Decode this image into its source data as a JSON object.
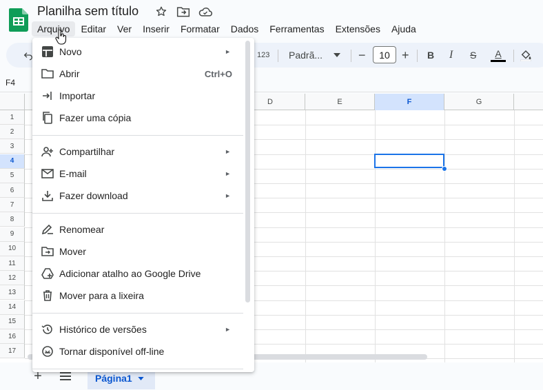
{
  "document": {
    "title": "Planilha sem título"
  },
  "menubar": [
    {
      "id": "arquivo",
      "label": "Arquivo",
      "active": true
    },
    {
      "id": "editar",
      "label": "Editar"
    },
    {
      "id": "ver",
      "label": "Ver"
    },
    {
      "id": "inserir",
      "label": "Inserir"
    },
    {
      "id": "formatar",
      "label": "Formatar"
    },
    {
      "id": "dados",
      "label": "Dados"
    },
    {
      "id": "ferramentas",
      "label": "Ferramentas"
    },
    {
      "id": "extensoes",
      "label": "Extensões"
    },
    {
      "id": "ajuda",
      "label": "Ajuda"
    }
  ],
  "toolbar": {
    "number_format": "123",
    "font_name": "Padrã...",
    "font_size": "10",
    "decrease": "−",
    "increase": "+",
    "bold": "B",
    "italic": "I",
    "strike": "S",
    "text_color": "A"
  },
  "namebox": {
    "value": "F4"
  },
  "grid": {
    "columns": [
      {
        "label": "D",
        "selected": false
      },
      {
        "label": "E",
        "selected": false
      },
      {
        "label": "F",
        "selected": true
      },
      {
        "label": "G",
        "selected": false
      }
    ],
    "rows": [
      "1",
      "2",
      "3",
      "4",
      "5",
      "6",
      "7",
      "8",
      "9",
      "10",
      "11",
      "12",
      "13",
      "14",
      "15",
      "16",
      "17"
    ],
    "selected_row": "4",
    "selected_color": "#1a73e8"
  },
  "file_menu": {
    "items": [
      {
        "id": "novo",
        "label": "Novo",
        "icon": "new-sheet-icon",
        "submenu": true,
        "shortcut": ""
      },
      {
        "id": "abrir",
        "label": "Abrir",
        "icon": "folder-icon",
        "submenu": false,
        "shortcut": "Ctrl+O"
      },
      {
        "id": "importar",
        "label": "Importar",
        "icon": "import-icon",
        "submenu": false,
        "shortcut": ""
      },
      {
        "id": "copia",
        "label": "Fazer uma cópia",
        "icon": "copy-icon",
        "submenu": false,
        "shortcut": ""
      },
      {
        "id": "compartilhar",
        "label": "Compartilhar",
        "icon": "person-add-icon",
        "submenu": true,
        "shortcut": ""
      },
      {
        "id": "email",
        "label": "E-mail",
        "icon": "mail-icon",
        "submenu": true,
        "shortcut": ""
      },
      {
        "id": "download",
        "label": "Fazer download",
        "icon": "download-icon",
        "submenu": true,
        "shortcut": ""
      },
      {
        "id": "renomear",
        "label": "Renomear",
        "icon": "rename-icon",
        "submenu": false,
        "shortcut": ""
      },
      {
        "id": "mover",
        "label": "Mover",
        "icon": "move-folder-icon",
        "submenu": false,
        "shortcut": ""
      },
      {
        "id": "atalho",
        "label": "Adicionar atalho ao Google Drive",
        "icon": "drive-shortcut-icon",
        "submenu": false,
        "shortcut": ""
      },
      {
        "id": "lixeira",
        "label": "Mover para a lixeira",
        "icon": "trash-icon",
        "submenu": false,
        "shortcut": ""
      },
      {
        "id": "historico",
        "label": "Histórico de versões",
        "icon": "history-icon",
        "submenu": true,
        "shortcut": ""
      },
      {
        "id": "offline",
        "label": "Tornar disponível off-line",
        "icon": "offline-icon",
        "submenu": false,
        "shortcut": ""
      }
    ]
  },
  "sheets": {
    "active": "Página1"
  }
}
